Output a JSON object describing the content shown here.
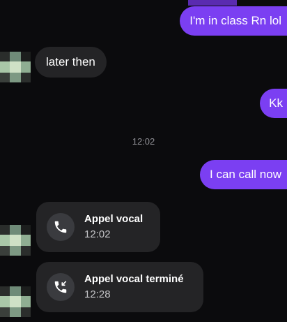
{
  "thread": {
    "messages": [
      {
        "id": "m1",
        "direction": "outgoing",
        "text": "I'm in class Rn lol"
      },
      {
        "id": "m2",
        "direction": "incoming",
        "text": "later then"
      },
      {
        "id": "m3",
        "direction": "outgoing",
        "text": "Kk"
      },
      {
        "id": "m4",
        "direction": "outgoing",
        "text": "I can call now"
      }
    ],
    "timestamp": "12:02",
    "calls": [
      {
        "title": "Appel vocal",
        "time": "12:02",
        "icon": "phone-icon"
      },
      {
        "title": "Appel vocal terminé",
        "time": "12:28",
        "icon": "phone-ended-icon"
      }
    ]
  },
  "colors": {
    "background": "#0b0b0d",
    "outgoing_bubble": "#7b3ff2",
    "incoming_bubble": "#242426",
    "timestamp": "#8e8e93",
    "call_icon_bg": "#3a3b3f"
  }
}
